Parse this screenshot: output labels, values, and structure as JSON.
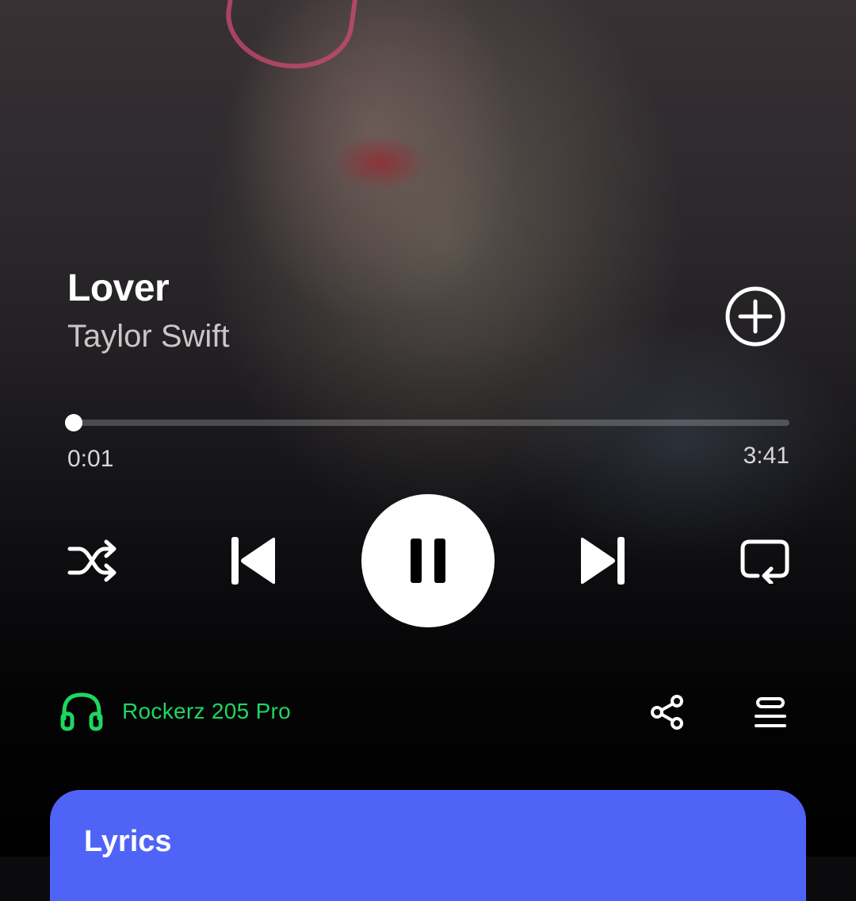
{
  "track": {
    "title": "Lover",
    "artist": "Taylor Swift"
  },
  "playback": {
    "elapsed": "0:01",
    "total": "3:41",
    "progress_fraction": 0.005,
    "state": "playing"
  },
  "icons": {
    "add": "add-circle-icon",
    "shuffle": "shuffle-icon",
    "previous": "skip-previous-icon",
    "pause": "pause-icon",
    "next": "skip-next-icon",
    "repeat": "repeat-icon",
    "headphones": "headphones-icon",
    "share": "share-icon",
    "queue": "queue-icon"
  },
  "device": {
    "label": "Rockerz 205 Pro"
  },
  "lyrics": {
    "title": "Lyrics"
  },
  "colors": {
    "accent_green": "#1ed760",
    "lyrics_card": "#4f63f7"
  }
}
